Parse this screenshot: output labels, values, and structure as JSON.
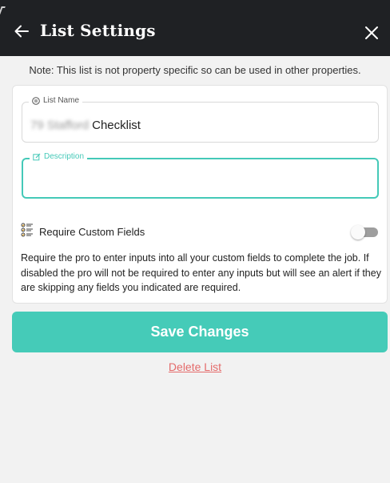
{
  "header": {
    "title": "List Settings",
    "back_icon": "arrow-left-icon",
    "close_icon": "close-icon"
  },
  "note": "Note: This list is not property specific so can be used in other properties.",
  "form": {
    "list_name": {
      "label": "List Name",
      "icon": "list-circle-icon",
      "value_redacted": "79 Stafford",
      "value": "Checklist"
    },
    "description": {
      "label": "Description",
      "icon": "edit-icon",
      "value": "",
      "placeholder": ""
    },
    "custom_fields": {
      "icon": "checklist-icon",
      "label": "Require Custom Fields",
      "enabled": false,
      "help": "Require the pro to enter inputs into all your custom fields to complete the job. If disabled the pro will not be required to enter any inputs but will see an alert if they are skipping any fields you indicated are required."
    }
  },
  "actions": {
    "save_label": "Save Changes",
    "delete_label": "Delete List"
  },
  "colors": {
    "header_bg": "#1f2124",
    "accent": "#45cbb8",
    "danger": "#e46b6b",
    "page_bg": "#f2f2f2"
  }
}
